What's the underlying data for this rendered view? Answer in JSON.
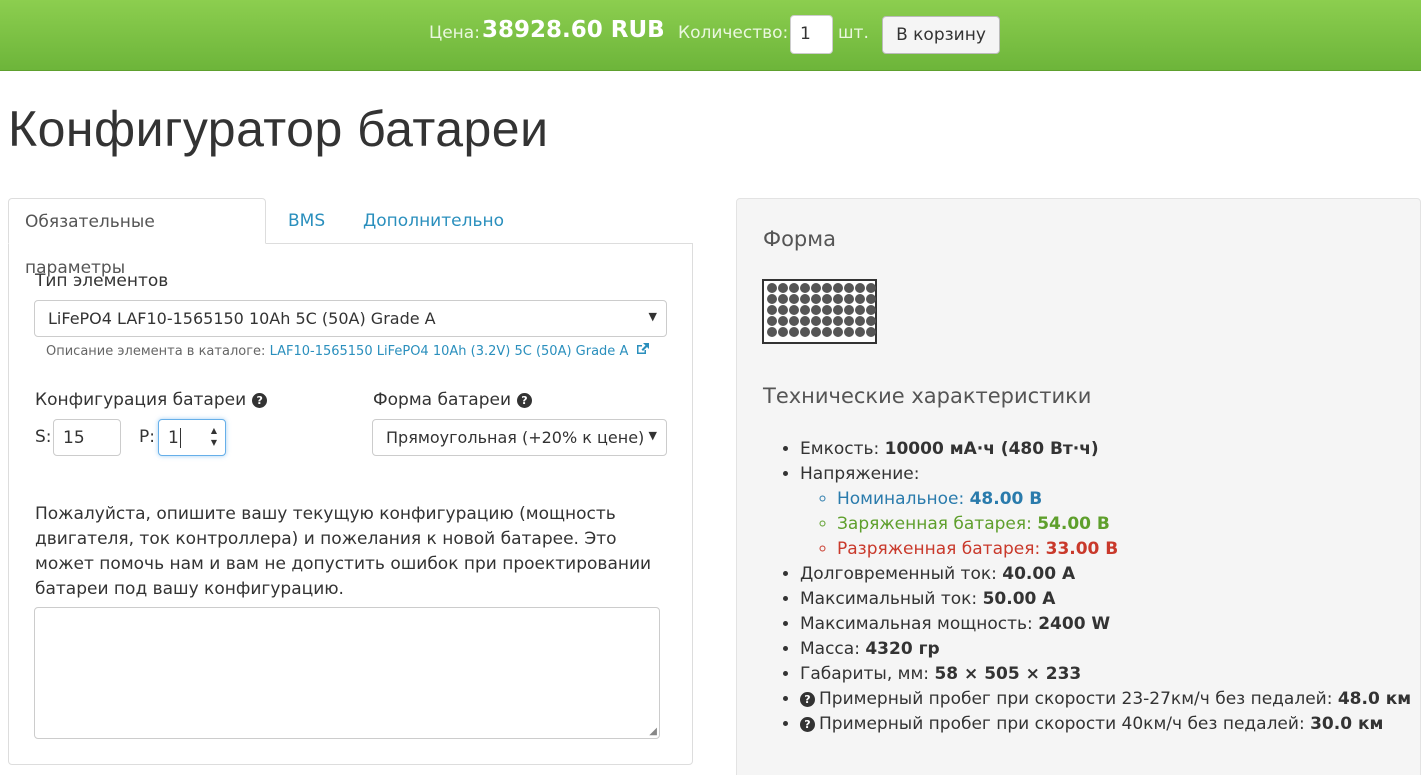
{
  "topbar": {
    "price_label": "Цена:",
    "price_value": "38928.60 RUB",
    "qty_label": "Количество:",
    "qty_value": "1",
    "qty_unit": "шт.",
    "cart_button": "В корзину",
    "bg_color": "#7cc047"
  },
  "page_title": "Конфигуратор батареи",
  "tabs": [
    {
      "label": "Обязательные параметры",
      "active": true
    },
    {
      "label": "BMS",
      "active": false
    },
    {
      "label": "Дополнительно",
      "active": false
    }
  ],
  "form": {
    "element_type_label": "Тип элементов",
    "element_type_value": "LiFePO4 LAF10-1565150 10Ah 5C (50A) Grade A",
    "catalog_hint_prefix": "Описание элемента в каталоге:",
    "catalog_hint_link": "LAF10-1565150 LiFePO4 10Ah (3.2V) 5C (50A) Grade A",
    "config_label": "Конфигурация батареи",
    "s_label": "S:",
    "s_value": "15",
    "p_label": "P:",
    "p_value": "1",
    "shape_label": "Форма батареи",
    "shape_value": "Прямоугольная (+20% к цене)",
    "description_text": "Пожалуйста, опишите вашу текущую конфигурацию (мощность двигателя, ток контроллера) и пожелания к новой батарее. Это может помочь нам и вам не допустить ошибок при проектировании батареи под вашу конфигурацию.",
    "textarea_value": ""
  },
  "info": {
    "shape_heading": "Форма",
    "shape_grid": {
      "columns": 10,
      "rows": 5
    },
    "specs_heading": "Технические характеристики",
    "capacity_label": "Емкость:",
    "capacity_value": "10000 мА·ч (480 Вт·ч)",
    "voltage_label": "Напряжение:",
    "nominal_label": "Номинальное:",
    "nominal_value": "48.00 В",
    "charged_label": "Заряженная батарея:",
    "charged_value": "54.00 В",
    "discharged_label": "Разряженная батарея:",
    "discharged_value": "33.00 В",
    "continuous_label": "Долговременный ток:",
    "continuous_value": "40.00 А",
    "max_current_label": "Максимальный ток:",
    "max_current_value": "50.00 А",
    "max_power_label": "Максимальная мощность:",
    "max_power_value": "2400 W",
    "mass_label": "Масса:",
    "mass_value": "4320 гр",
    "dims_label": "Габариты, мм:",
    "dims_value": "58 × 505 × 233",
    "range1_label": "Примерный пробег при скорости 23-27км/ч без педалей:",
    "range1_value": "48.0 км",
    "range2_label": "Примерный пробег при скорости 40км/ч без педалей:",
    "range2_value": "30.0 км"
  }
}
